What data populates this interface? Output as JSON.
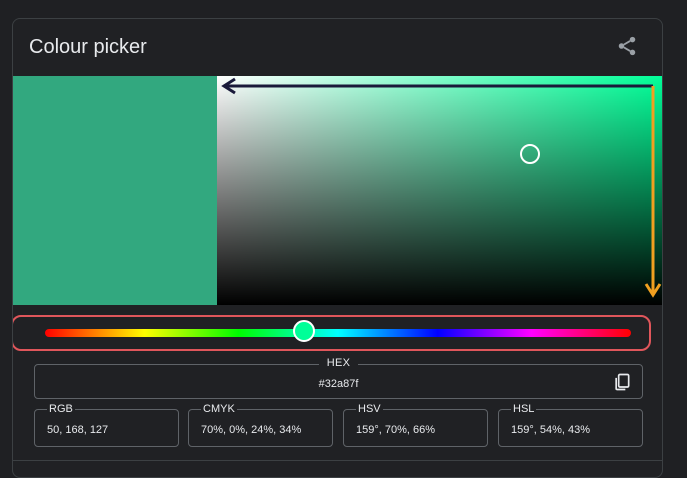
{
  "card": {
    "title": "Colour picker"
  },
  "colors": {
    "current": "#32a87f",
    "hue_base": "#00ff98",
    "accent_arrow_dark": "#1a1a3a",
    "accent_arrow_orange": "#f0a020",
    "highlight_border": "#e0565b"
  },
  "icons": {
    "share": "share-icon",
    "copy": "copy-icon"
  },
  "picker": {
    "hue_degrees": 159,
    "saturation": 0.7,
    "value": 0.66
  },
  "hex": {
    "label": "HEX",
    "value": "#32a87f"
  },
  "fields": [
    {
      "label": "RGB",
      "value": "50, 168, 127"
    },
    {
      "label": "CMYK",
      "value": "70%, 0%, 24%, 34%"
    },
    {
      "label": "HSV",
      "value": "159°, 70%, 66%"
    },
    {
      "label": "HSL",
      "value": "159°, 54%, 43%"
    }
  ]
}
